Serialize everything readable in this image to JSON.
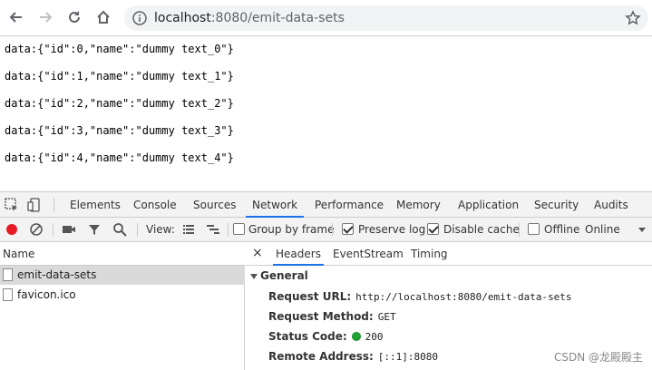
{
  "browser": {
    "url_host": "localhost",
    "url_rest": ":8080/emit-data-sets"
  },
  "page": {
    "lines": [
      "data:{\"id\":0,\"name\":\"dummy text_0\"}",
      "data:{\"id\":1,\"name\":\"dummy text_1\"}",
      "data:{\"id\":2,\"name\":\"dummy text_2\"}",
      "data:{\"id\":3,\"name\":\"dummy text_3\"}",
      "data:{\"id\":4,\"name\":\"dummy text_4\"}"
    ]
  },
  "devtools": {
    "tabs": [
      "Elements",
      "Console",
      "Sources",
      "Network",
      "Performance",
      "Memory",
      "Application",
      "Security",
      "Audits"
    ],
    "active_tab": "Network",
    "toolbar": {
      "view_label": "View:",
      "group_by_frame": "Group by frame",
      "preserve_log": "Preserve log",
      "disable_cache": "Disable cache",
      "offline": "Offline",
      "throttle": "Online"
    },
    "requests": {
      "header": "Name",
      "items": [
        "emit-data-sets",
        "favicon.ico"
      ]
    },
    "details": {
      "close": "×",
      "tabs": [
        "Headers",
        "EventStream",
        "Timing"
      ],
      "section": "General",
      "request_url_label": "Request URL:",
      "request_url": "http://localhost:8080/emit-data-sets",
      "request_method_label": "Request Method:",
      "request_method": "GET",
      "status_code_label": "Status Code:",
      "status_code": "200",
      "remote_address_label": "Remote Address:",
      "remote_address": "[::1]:8080"
    }
  },
  "watermark": "CSDN @龙殿殿主"
}
